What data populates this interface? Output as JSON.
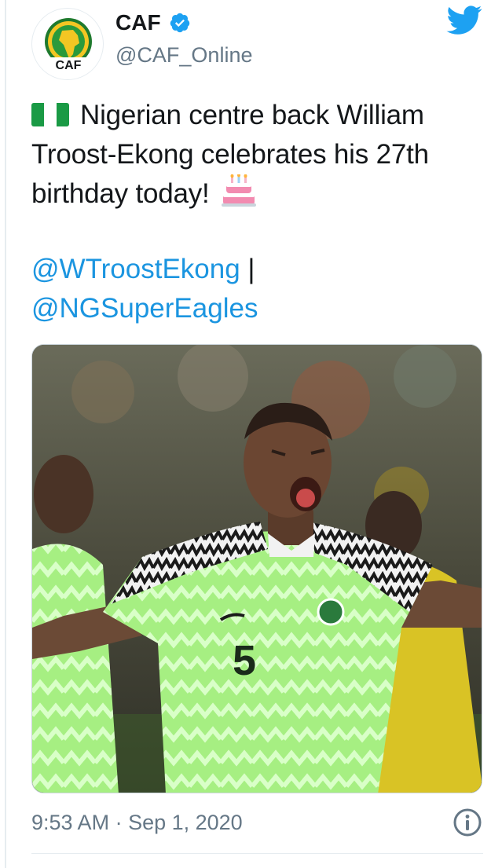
{
  "author": {
    "name": "CAF",
    "handle": "@CAF_Online",
    "avatar_text": "CAF",
    "verified_icon": "verified-badge-icon",
    "platform_icon": "twitter-bird-icon"
  },
  "tweet": {
    "line1": "Nigerian centre back William",
    "line2": "Troost-Ekong celebrates his 27th",
    "line3": "birthday today!",
    "emoji_flag": "nigeria-flag-icon",
    "emoji_cake": "birthday-cake-icon",
    "mention1": "@WTroostEkong",
    "separator": " |",
    "mention2": "@NGSuperEagles",
    "jersey_number": "5"
  },
  "meta": {
    "time": "9:53 AM",
    "dot": " · ",
    "date": "Sep 1, 2020"
  },
  "colors": {
    "link": "#1b95e0",
    "text": "#14171a",
    "muted": "#657786",
    "kit_green": "#9ee87a"
  }
}
